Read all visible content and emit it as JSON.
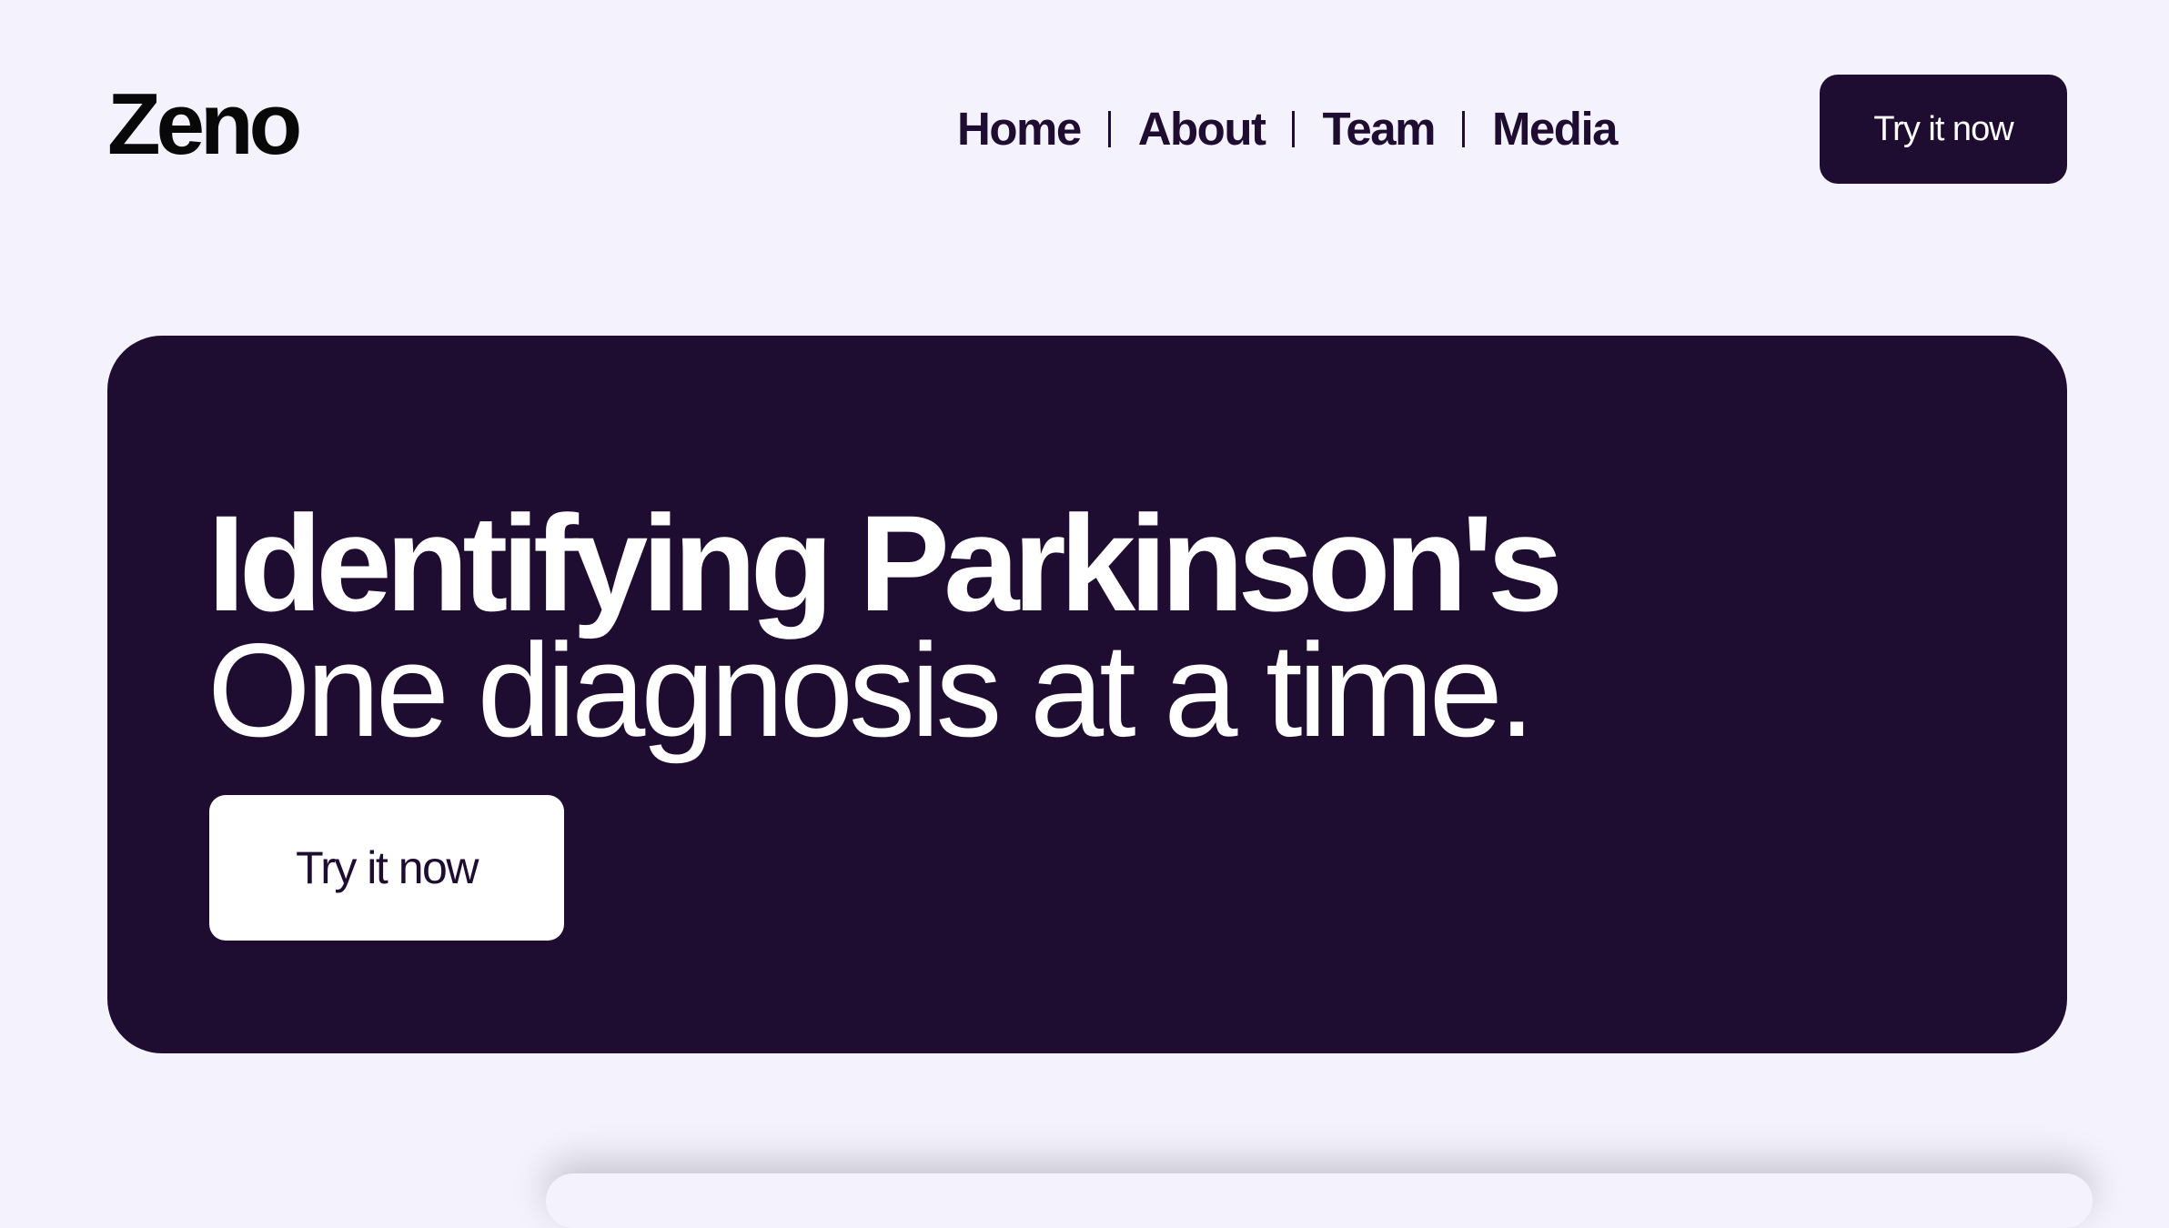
{
  "header": {
    "logo": "Zeno",
    "nav": {
      "items": [
        {
          "label": "Home"
        },
        {
          "label": "About"
        },
        {
          "label": "Team"
        },
        {
          "label": "Media"
        }
      ]
    },
    "cta_label": "Try it now"
  },
  "hero": {
    "title": "Identifying Parkinson's",
    "subtitle": "One diagnosis at a time.",
    "cta_label": "Try it now"
  },
  "colors": {
    "background": "#f3f2fd",
    "primary": "#1f0d31",
    "on_primary": "#ffffff"
  }
}
